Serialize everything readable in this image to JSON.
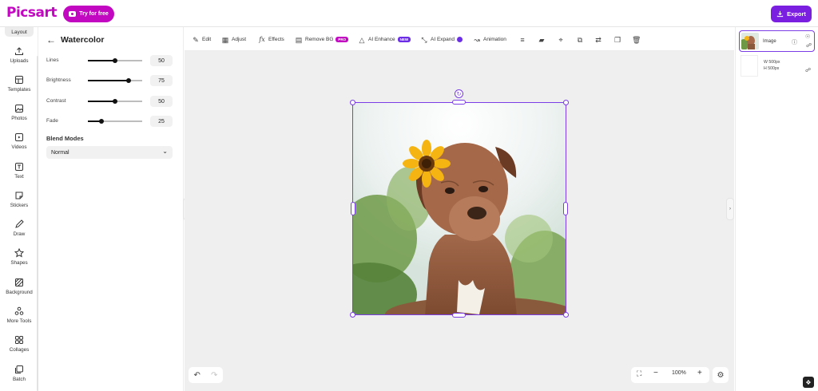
{
  "header": {
    "logo": "Picsart",
    "try_label": "Try for free",
    "export_label": "Export"
  },
  "rail": {
    "active_label": "Layout",
    "items": [
      {
        "label": "Uploads",
        "icon": "upload-icon"
      },
      {
        "label": "Templates",
        "icon": "templates-icon"
      },
      {
        "label": "Photos",
        "icon": "photos-icon"
      },
      {
        "label": "Videos",
        "icon": "videos-icon"
      },
      {
        "label": "Text",
        "icon": "text-icon"
      },
      {
        "label": "Stickers",
        "icon": "stickers-icon"
      },
      {
        "label": "Draw",
        "icon": "draw-icon"
      },
      {
        "label": "Shapes",
        "icon": "shapes-icon"
      },
      {
        "label": "Background",
        "icon": "background-icon"
      },
      {
        "label": "More Tools",
        "icon": "more-tools-icon"
      },
      {
        "label": "Collages",
        "icon": "collages-icon"
      },
      {
        "label": "Batch",
        "icon": "batch-icon"
      }
    ]
  },
  "panel": {
    "title": "Watercolor",
    "sliders": [
      {
        "label": "Lines",
        "value": "50",
        "fraction": 0.5
      },
      {
        "label": "Brightness",
        "value": "75",
        "fraction": 0.75
      },
      {
        "label": "Contrast",
        "value": "50",
        "fraction": 0.5
      },
      {
        "label": "Fade",
        "value": "25",
        "fraction": 0.25
      }
    ],
    "blend_label": "Blend Modes",
    "blend_value": "Normal"
  },
  "toolbar": {
    "edit": "Edit",
    "adjust": "Adjust",
    "effects": "Effects",
    "remove_bg": "Remove BG",
    "remove_bg_badge": "PRO",
    "ai_enhance": "AI Enhance",
    "ai_enhance_badge": "NEW",
    "ai_expand": "AI Expand",
    "animation": "Animation"
  },
  "zoom": {
    "level": "100%"
  },
  "layers": {
    "image_name": "Image",
    "width": "W 500px",
    "height": "H 500px"
  },
  "colors": {
    "brand": "#c209c1",
    "accent": "#7a1fe0",
    "selection": "#7a3de6"
  }
}
